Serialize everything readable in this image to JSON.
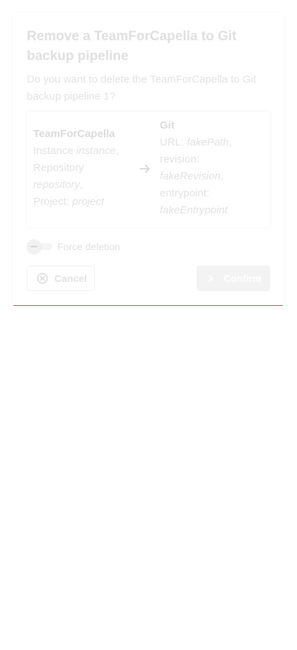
{
  "dialog": {
    "title": "Remove a TeamForCapella to Git backup pipeline",
    "message": "Do you want to delete the TeamForCapella to Git backup pipeline 1?"
  },
  "pipeline": {
    "source": {
      "heading": "TeamForCapella",
      "instance_label": "Instance",
      "instance_value": "instance",
      "repository_label": "Repository",
      "repository_value": "repository",
      "project_label": "Project:",
      "project_value": "project"
    },
    "arrow_icon": "arrow-right-icon",
    "target": {
      "heading": "Git",
      "url_label": "URL:",
      "url_value": "fakePath",
      "revision_label": "revision:",
      "revision_value": "fakeRevision",
      "entrypoint_label": "entrypoint:",
      "entrypoint_value": "fakeEntrypoint"
    }
  },
  "force_toggle": {
    "label": "Force deletion",
    "checked": false
  },
  "actions": {
    "cancel_label": "Cancel",
    "cancel_icon": "cancel-circle-icon",
    "confirm_label": "Confirm",
    "confirm_icon": "chevron-right-icon"
  },
  "colors": {
    "bottom_line": "#c0505e"
  }
}
